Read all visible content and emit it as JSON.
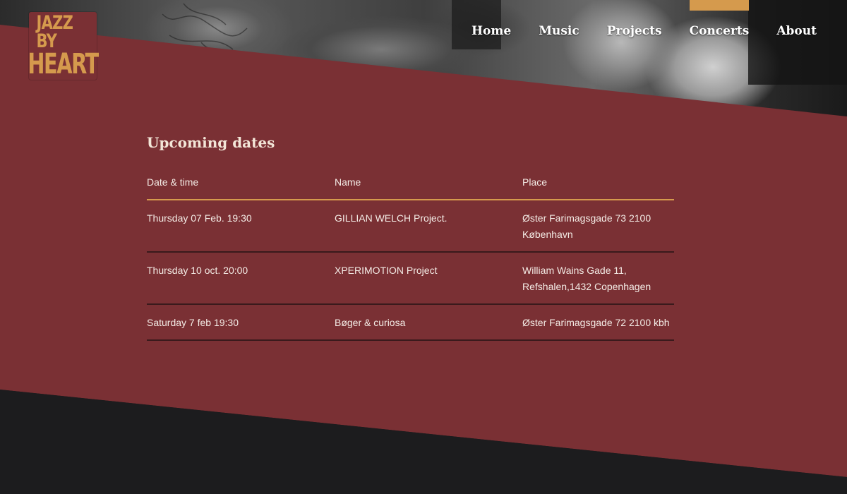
{
  "logo": {
    "line1": "JAZZ BY",
    "line2": "HEART"
  },
  "nav": {
    "items": [
      {
        "label": "Home",
        "active": false
      },
      {
        "label": "Music",
        "active": false
      },
      {
        "label": "Projects",
        "active": false
      },
      {
        "label": "Concerts",
        "active": true
      },
      {
        "label": "About",
        "active": false
      }
    ]
  },
  "concerts": {
    "title": "Upcoming dates",
    "columns": [
      "Date & time",
      "Name",
      "Place"
    ],
    "rows": [
      {
        "date": "Thursday 07 Feb. 19:30",
        "name": "GILLIAN WELCH Project.",
        "place": "Øster Farimagsgade 73 2100 København"
      },
      {
        "date": "Thursday 10 oct. 20:00",
        "name": "XPERIMOTION Project",
        "place": "William Wains Gade 11, Refshalen,1432 Copenhagen"
      },
      {
        "date": "Saturday 7 feb 19:30",
        "name": "Bøger & curiosa",
        "place": "Øster Farimagsgade 72 2100 kbh"
      }
    ]
  },
  "colors": {
    "accent": "#d59a4d",
    "maroon": "#7a3034",
    "dark": "#1c1c1e"
  }
}
